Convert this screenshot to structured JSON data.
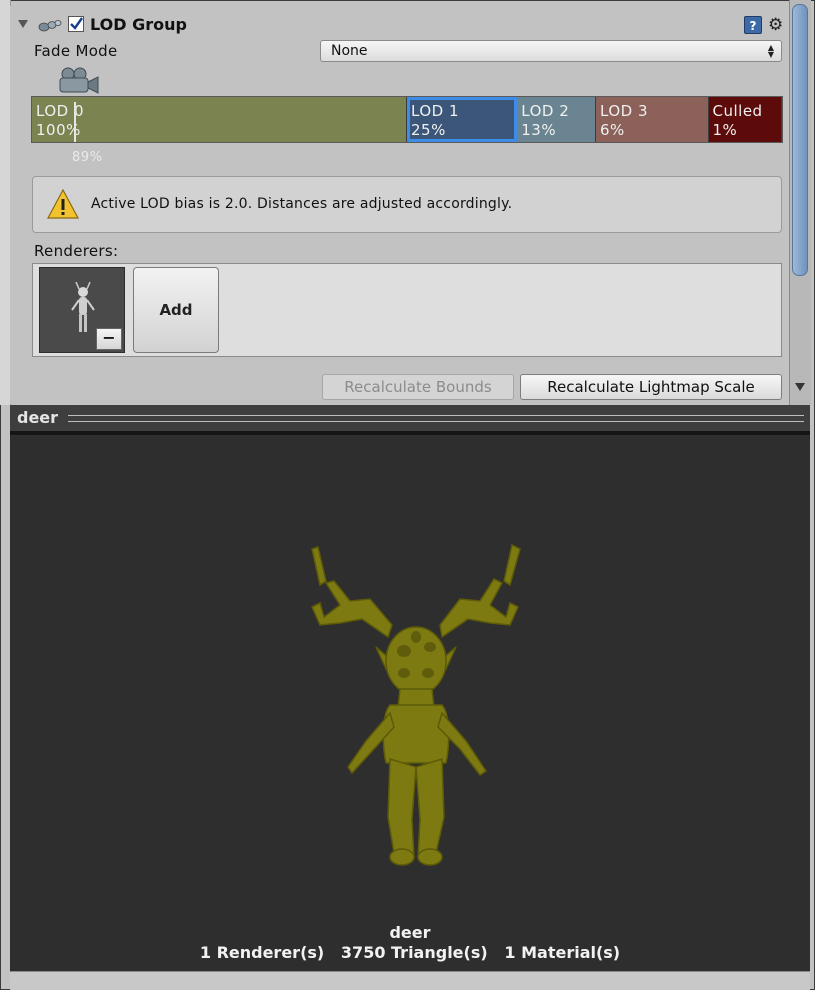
{
  "component": {
    "title": "LOD Group",
    "enabled": true,
    "icons": [
      "lod-group-component-icon",
      "help-icon",
      "gear-icon"
    ]
  },
  "fade_mode": {
    "label": "Fade Mode",
    "value": "None"
  },
  "lod_levels": [
    {
      "name": "LOD 0",
      "percent": "100%",
      "color": "#7b8350",
      "fraction": 0.5
    },
    {
      "name": "LOD 1",
      "percent": "25%",
      "color": "#3b5678",
      "fraction": 0.147,
      "selected": true
    },
    {
      "name": "LOD 2",
      "percent": "13%",
      "color": "#6a8591",
      "fraction": 0.105
    },
    {
      "name": "LOD 3",
      "percent": "6%",
      "color": "#8b6159",
      "fraction": 0.15
    },
    {
      "name": "Culled",
      "percent": "1%",
      "color": "#5c0a0a",
      "fraction": 0.098
    }
  ],
  "camera": {
    "percent": "89%",
    "icon": "camera-icon"
  },
  "help_box": {
    "icon": "warning-icon",
    "text": "Active LOD bias is 2.0. Distances are adjusted accordingly."
  },
  "renderers": {
    "label": "Renderers:",
    "add_label": "Add",
    "remove_label": "−"
  },
  "buttons": {
    "recalc_bounds": "Recalculate Bounds",
    "recalc_lightmap": "Recalculate Lightmap Scale"
  },
  "preview": {
    "title": "deer",
    "model_name": "deer",
    "stats": "1 Renderer(s)   3750 Triangle(s)   1 Material(s)",
    "model_color": "#7d7a12"
  }
}
